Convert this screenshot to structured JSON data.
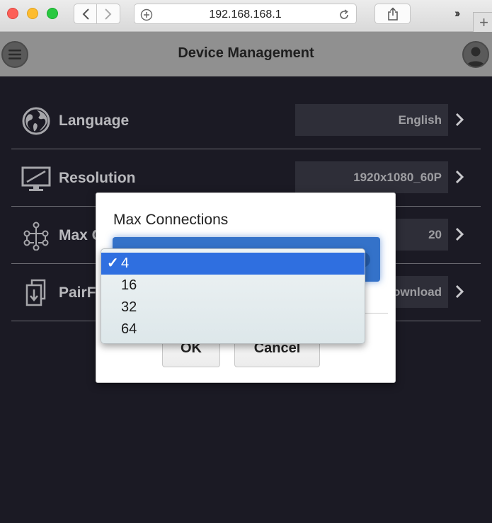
{
  "browser": {
    "url": "192.168.168.1"
  },
  "header": {
    "title": "Device Management"
  },
  "settings": {
    "rows": [
      {
        "label": "Language",
        "value": "English",
        "icon": "globe-icon"
      },
      {
        "label": "Resolution",
        "value": "1920x1080_60P",
        "icon": "monitor-icon"
      },
      {
        "label": "Max C",
        "value": "20",
        "icon": "network-icon"
      },
      {
        "label": "PairF",
        "value": "ownload",
        "icon": "download-file-icon"
      }
    ]
  },
  "dialog": {
    "title": "Max Connections",
    "ok_label": "OK",
    "cancel_label": "Cancel"
  },
  "dropdown": {
    "options": [
      "4",
      "16",
      "32",
      "64"
    ],
    "selected": "4",
    "check_glyph": "✓"
  },
  "colors": {
    "app_background": "#1b1a24",
    "header_background": "#909090",
    "select_accent": "#3472c9",
    "selected_option": "#2f6fe0"
  }
}
